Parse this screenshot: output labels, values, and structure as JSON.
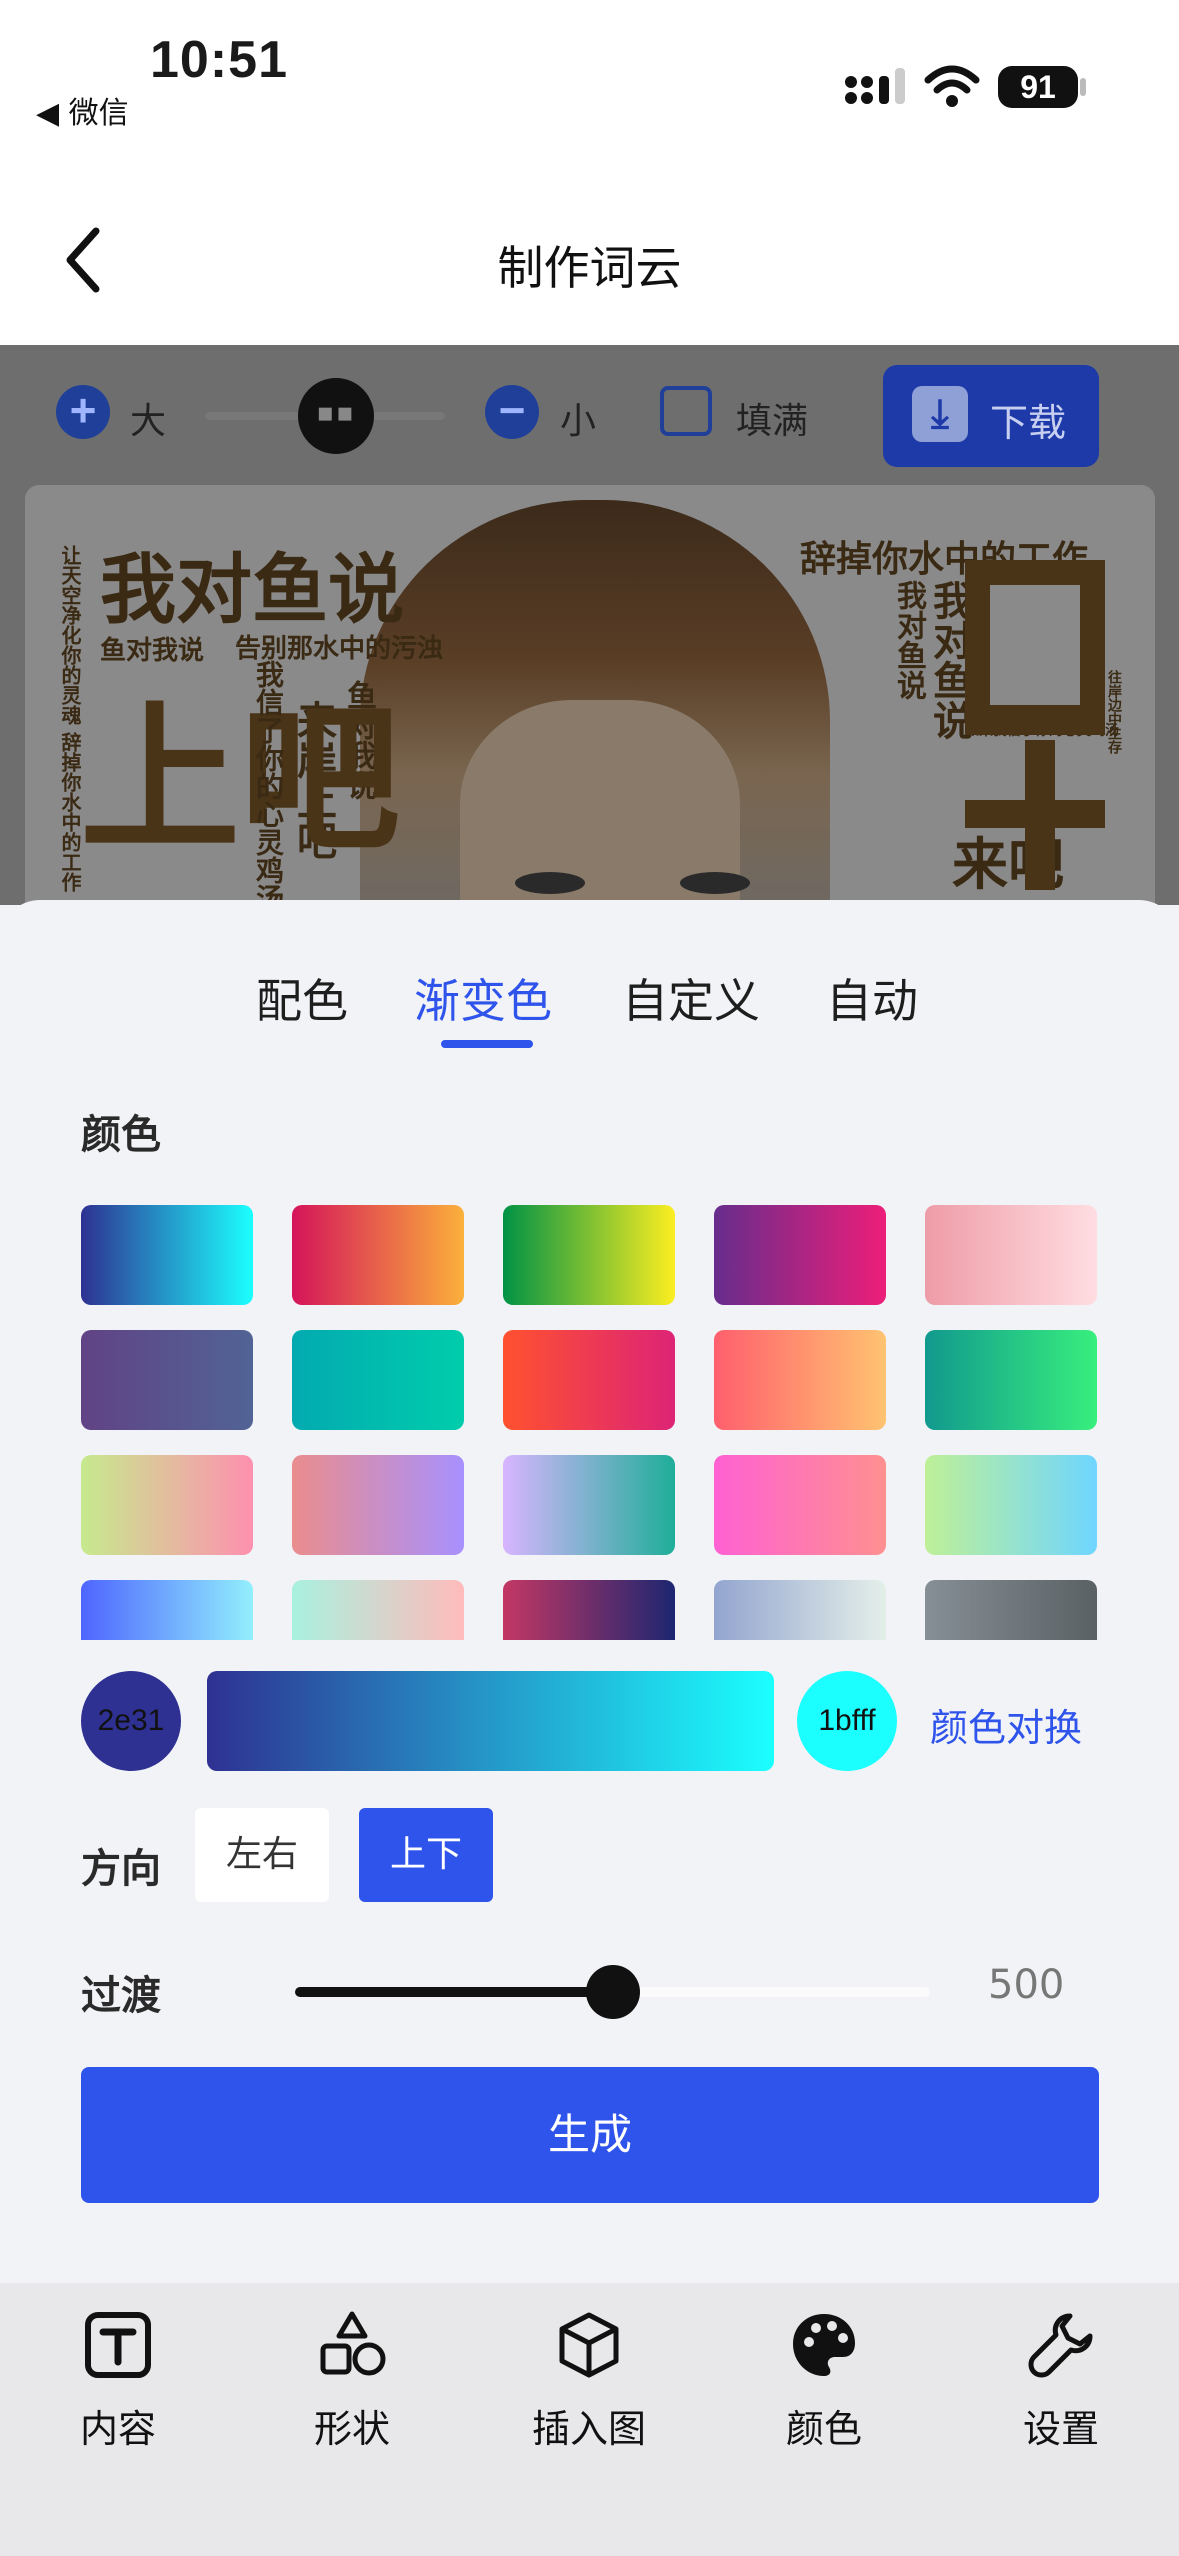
{
  "status_bar": {
    "time": "10:51",
    "back_app": "◀ 微信",
    "battery": "91"
  },
  "nav": {
    "title": "制作词云"
  },
  "preview_toolbar": {
    "bigger_label": "大",
    "smaller_label": "小",
    "fill_label": "填满",
    "download_label": "下载"
  },
  "word_cloud_words": {
    "w1": "我对鱼说",
    "w2": "辞掉你水中的工作",
    "w3": "鱼对我说",
    "w4": "告别那水中的污浊",
    "w5": "来岸上吧",
    "w6": "鱼对我说",
    "w7": "我对鱼说",
    "w8": "如果我信了你的心灵鸡汤",
    "w9": "来吧",
    "w10": "上吧",
    "w11": "我对鱼说",
    "w12": "让天空净化你的灵魂 辞掉你水中的工作",
    "w13": "我信了你的心灵鸡汤",
    "w14": "往岸边中生存"
  },
  "tabs": [
    {
      "label": "配色"
    },
    {
      "label": "渐变色"
    },
    {
      "label": "自定义"
    },
    {
      "label": "自动"
    }
  ],
  "active_tab": "渐变色",
  "color_section": {
    "heading": "颜色"
  },
  "gradients": [
    [
      "#2e3192",
      "#1bffff"
    ],
    [
      "#d4145a",
      "#fbb03b"
    ],
    [
      "#009245",
      "#fcee21"
    ],
    [
      "#662d8c",
      "#ed1e79"
    ],
    [
      "#ee9ca7",
      "#ffdde1"
    ],
    [
      "#614385",
      "#516395"
    ],
    [
      "#02aab0",
      "#00cdac"
    ],
    [
      "#ff512f",
      "#dd2476"
    ],
    [
      "#ff5f6d",
      "#ffc371"
    ],
    [
      "#11998e",
      "#38ef7d"
    ],
    [
      "#c6ea8d",
      "#fe90af"
    ],
    [
      "#ea8d8d",
      "#a890fe"
    ],
    [
      "#d8b5ff",
      "#1eae98"
    ],
    [
      "#ff61d2",
      "#fe9090"
    ],
    [
      "#bff098",
      "#6fd6ff"
    ],
    [
      "#4e65ff",
      "#92effd"
    ],
    [
      "#a9f1df",
      "#ffbbbb"
    ],
    [
      "#c33764",
      "#1d2671"
    ],
    [
      "#93a5cf",
      "#e4efe9"
    ],
    [
      "#868f96",
      "#596164"
    ]
  ],
  "selected_gradient": {
    "start_label": "2e31",
    "start_color": "#2e3192",
    "end_label": "1bfff",
    "end_color": "#1bffff",
    "swap_label": "颜色对换"
  },
  "direction": {
    "label": "方向",
    "options": [
      "左右",
      "上下"
    ],
    "selected": "上下"
  },
  "transition": {
    "label": "过渡",
    "value": "500",
    "fraction": 0.5
  },
  "generate_label": "生成",
  "bottom_nav": [
    {
      "label": "内容",
      "icon": "text-box-icon"
    },
    {
      "label": "形状",
      "icon": "shapes-icon"
    },
    {
      "label": "插入图",
      "icon": "cube-icon"
    },
    {
      "label": "颜色",
      "icon": "palette-icon"
    },
    {
      "label": "设置",
      "icon": "wrench-icon"
    }
  ]
}
